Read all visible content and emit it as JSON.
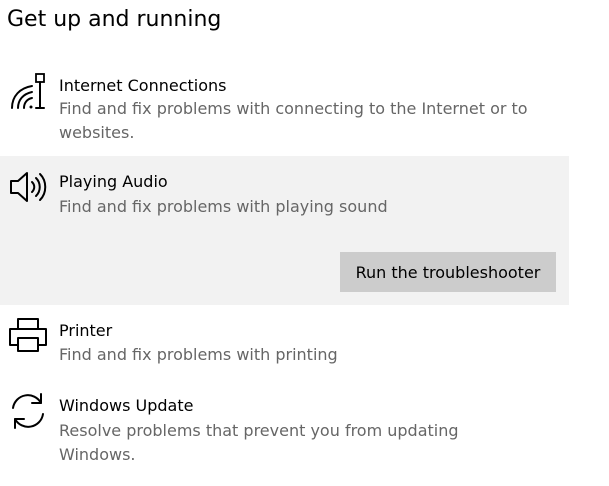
{
  "section": {
    "title": "Get up and running"
  },
  "items": [
    {
      "title": "Internet Connections",
      "description": "Find and fix problems with connecting to the Internet or to websites.",
      "icon": "wifi-network-icon"
    },
    {
      "title": "Playing Audio",
      "description": "Find and fix problems with playing sound",
      "icon": "speaker-icon",
      "button_label": "Run the troubleshooter"
    },
    {
      "title": "Printer",
      "description": "Find and fix problems with printing",
      "icon": "printer-icon"
    },
    {
      "title": "Windows Update",
      "description": "Resolve problems that prevent you from updating Windows.",
      "icon": "refresh-sync-icon"
    }
  ],
  "colors": {
    "selected_background": "#f2f2f2",
    "button_background": "#cccccc",
    "description_text": "#666666"
  }
}
